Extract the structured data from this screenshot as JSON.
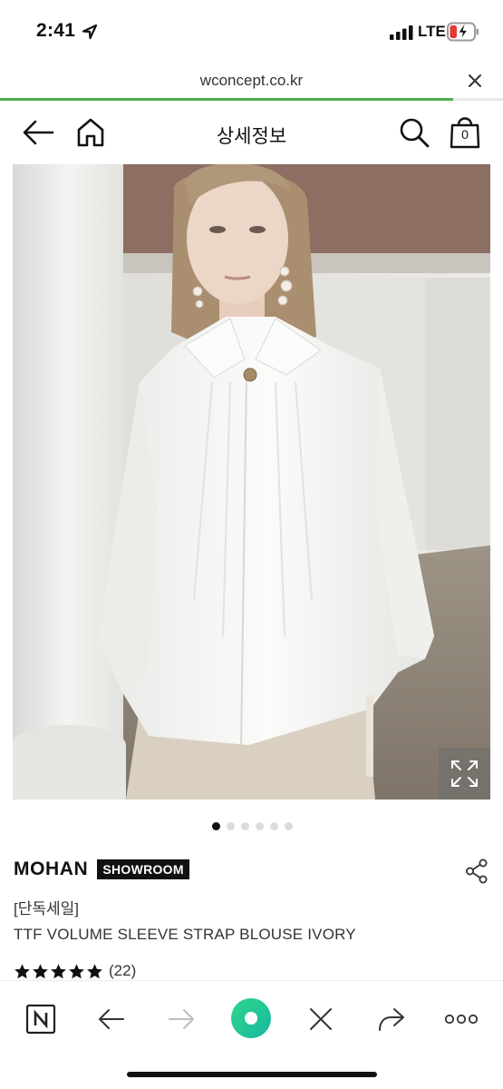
{
  "status_bar": {
    "time": "2:41",
    "network": "LTE",
    "battery_level": 0.3,
    "battery_charging": true,
    "battery_color": "#e53935"
  },
  "browser": {
    "url": "wconcept.co.kr",
    "load_progress": 0.9,
    "progress_color": "#4caf50"
  },
  "header": {
    "title": "상세정보",
    "cart_count": "0"
  },
  "gallery": {
    "image_count": 6,
    "active_index": 0
  },
  "product": {
    "brand": "MOHAN",
    "badge": "SHOWROOM",
    "sale_label": "[단독세일]",
    "name": "TTF VOLUME SLEEVE STRAP BLOUSE IVORY",
    "rating": 5,
    "review_count": "(22)"
  },
  "toolbar": {
    "items": [
      "naver-n-icon",
      "back-arrow-icon",
      "forward-arrow-icon",
      "green-dot-icon",
      "close-icon",
      "share-arrow-icon",
      "more-icon"
    ],
    "accent": "#22c97a"
  }
}
